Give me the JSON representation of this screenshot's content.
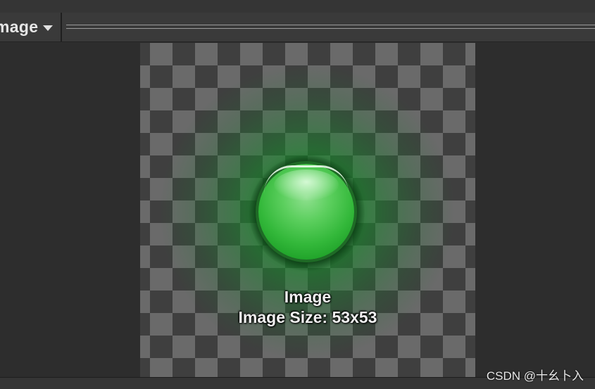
{
  "toolbar": {
    "view_label": "mage",
    "caret_icon": "caret-down-icon"
  },
  "preview": {
    "title": "Image",
    "size_label": "Image Size: 53x53",
    "orb_color": "#33b83a"
  },
  "watermark": "CSDN @十幺卜入"
}
